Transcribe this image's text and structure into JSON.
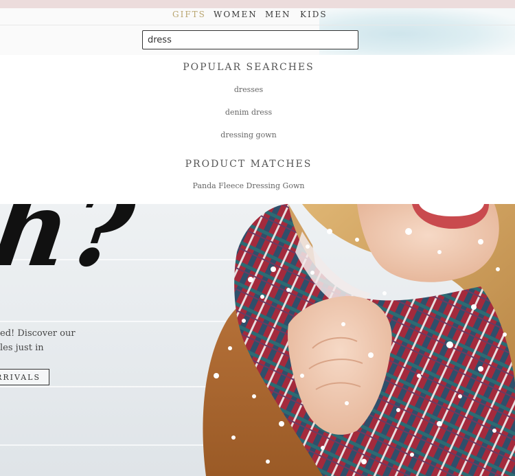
{
  "nav": {
    "items": [
      {
        "label": "GIFTS",
        "active": true
      },
      {
        "label": "WOMEN",
        "active": false
      },
      {
        "label": "MEN",
        "active": false
      },
      {
        "label": "KIDS",
        "active": false
      }
    ]
  },
  "search": {
    "value": "dress"
  },
  "dropdown": {
    "popular_heading": "POPULAR SEARCHES",
    "popular": [
      "dresses",
      "denim dress",
      "dressing gown"
    ],
    "product_heading": "PRODUCT MATCHES",
    "products": [
      "Panda Fleece Dressing Gown"
    ]
  },
  "hero": {
    "headline": "h?",
    "copy_line_1": "ed! Discover our",
    "copy_line_2": "les just in",
    "cta": "RRIVALS"
  },
  "colors": {
    "accent_gold": "#b8a46e",
    "text_dark": "#3a3a3a",
    "scarf_red": "#9b2335",
    "coat_tan": "#a8672e"
  }
}
